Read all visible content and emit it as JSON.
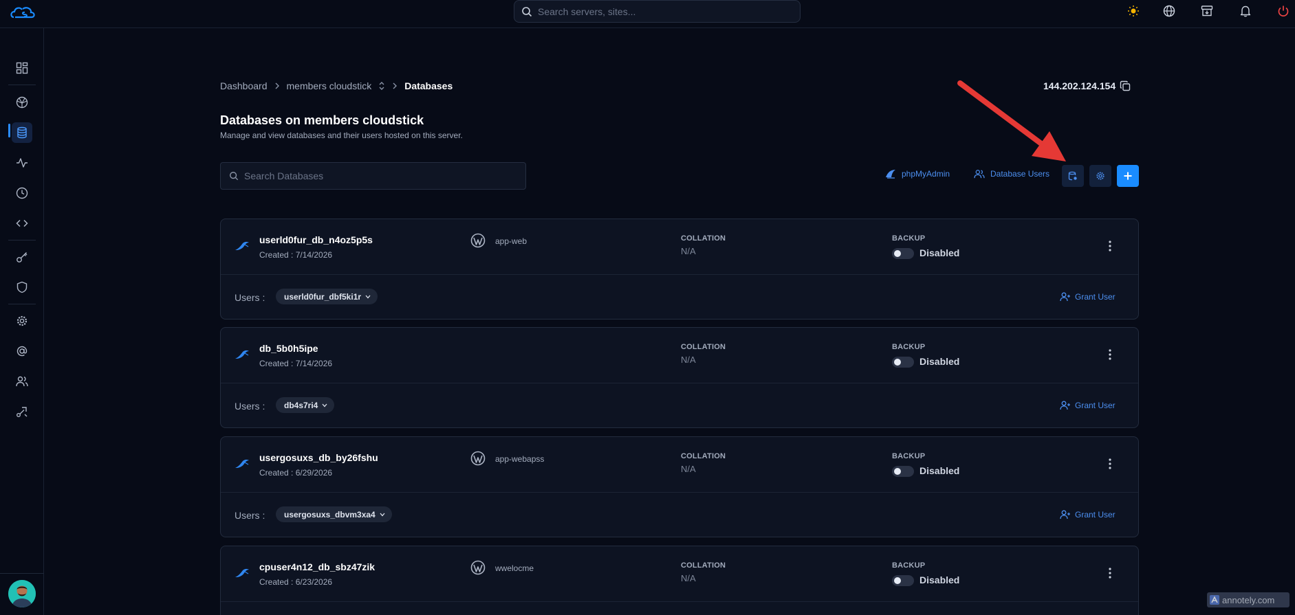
{
  "topbar": {
    "search_placeholder": "Search servers, sites...",
    "icons": [
      "sun-icon",
      "globe-icon",
      "archive-icon",
      "bell-icon",
      "power-icon"
    ]
  },
  "sidebar": {
    "items": [
      "dashboard-icon",
      "server-icon",
      "database-icon",
      "activity-icon",
      "clock-icon",
      "code-icon",
      "key-icon",
      "shield-icon",
      "gear-icon",
      "at-icon",
      "users-icon",
      "route-icon"
    ],
    "active": "database-icon"
  },
  "breadcrumb": {
    "items": [
      "Dashboard",
      "members cloudstick",
      "Databases"
    ]
  },
  "server_ip": "144.202.124.154",
  "page": {
    "title": "Databases on members cloudstick",
    "subtitle": "Manage and view databases and their users hosted on this server.",
    "search_placeholder": "Search Databases"
  },
  "toolbar": {
    "phpmyadmin": "phpMyAdmin",
    "database_users": "Database Users"
  },
  "labels": {
    "collation": "COLLATION",
    "backup": "BACKUP",
    "users": "Users :",
    "grant_user": "Grant User"
  },
  "databases": [
    {
      "name": "userld0fur_db_n4oz5p5s",
      "created": "Created : 7/14/2026",
      "app": "app-web",
      "collation": "N/A",
      "backup": "Disabled",
      "user": "userld0fur_dbf5ki1r"
    },
    {
      "name": "db_5b0h5ipe",
      "created": "Created : 7/14/2026",
      "app": "",
      "collation": "N/A",
      "backup": "Disabled",
      "user": "db4s7ri4"
    },
    {
      "name": "usergosuxs_db_by26fshu",
      "created": "Created : 6/29/2026",
      "app": "app-webapss",
      "collation": "N/A",
      "backup": "Disabled",
      "user": "usergosuxs_dbvm3xa4"
    },
    {
      "name": "cpuser4n12_db_sbz47zik",
      "created": "Created : 6/23/2026",
      "app": "wwelocme",
      "collation": "N/A",
      "backup": "Disabled",
      "user": ""
    }
  ],
  "watermark": "annotely.com",
  "colors": {
    "background": "#070b17",
    "card": "#0d1322",
    "accent": "#1a8cff",
    "link": "#4c8ff0",
    "annotation_arrow": "#e53935"
  }
}
